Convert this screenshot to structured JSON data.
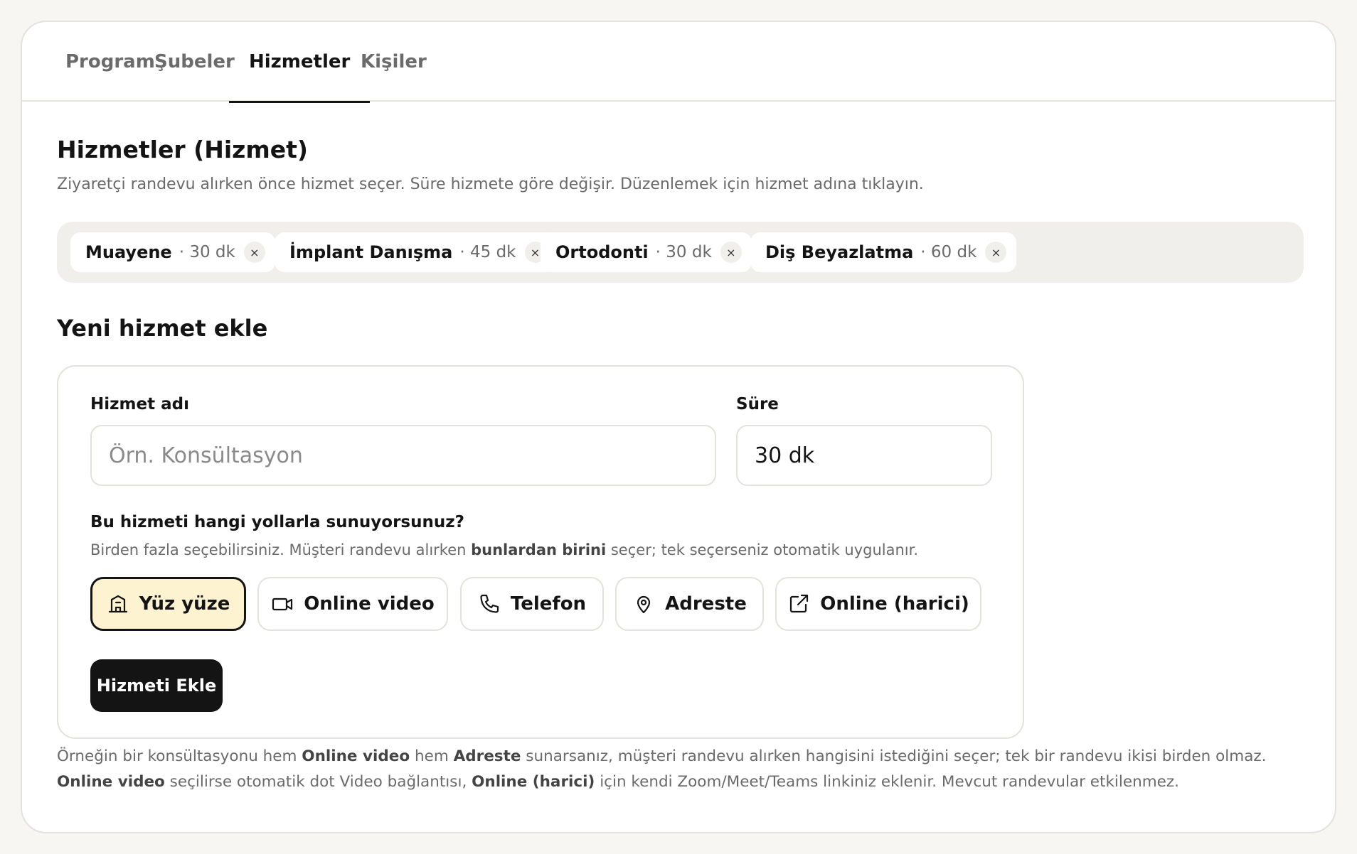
{
  "tabs": [
    {
      "label": "Program"
    },
    {
      "label": "Şubeler"
    },
    {
      "label": "Hizmetler",
      "active": true
    },
    {
      "label": "Kişiler"
    }
  ],
  "services": {
    "title": "Hizmetler (Hizmet)",
    "subtitle": "Ziyaretçi randevu alırken önce hizmet seçer. Süre hizmete göre değişir. Düzenlemek için hizmet adına tıklayın.",
    "items": [
      {
        "name": "Muayene",
        "duration": "· 30 dk"
      },
      {
        "name": "İmplant Danışma",
        "duration": "· 45 dk"
      },
      {
        "name": "Ortodonti",
        "duration": "· 30 dk"
      },
      {
        "name": "Diş Beyazlatma",
        "duration": "· 60 dk"
      }
    ],
    "remove_glyph": "×"
  },
  "new_service": {
    "title": "Yeni hizmet ekle",
    "name_label": "Hizmet adı",
    "name_placeholder": "Örn. Konsültasyon",
    "name_value": "",
    "duration_label": "Süre",
    "duration_value": "30 dk",
    "question": "Bu hizmeti hangi yollarla sunuyorsunuz?",
    "hint_prefix": "Birden fazla seçebilirsiniz. Müşteri randevu alırken ",
    "hint_bold": "bunlardan birini",
    "hint_suffix": " seçer; tek seçerseniz otomatik uygulanır.",
    "options": [
      {
        "label": "Yüz yüze",
        "icon": "building-icon",
        "selected": true
      },
      {
        "label": "Online video",
        "icon": "video-icon",
        "selected": false
      },
      {
        "label": "Telefon",
        "icon": "phone-icon",
        "selected": false
      },
      {
        "label": "Adreste",
        "icon": "map-pin-icon",
        "selected": false
      },
      {
        "label": "Online (harici)",
        "icon": "external-link-icon",
        "selected": false
      }
    ],
    "submit_label": "Hizmeti Ekle"
  },
  "note": {
    "p1": "Örneğin bir konsültasyonu hem ",
    "b1": "Online video",
    "p2": " hem ",
    "b2": "Adreste",
    "p3": " sunarsanız, müşteri randevu alırken hangisini istediğini seçer; tek bir randevu ikisi birden olmaz. ",
    "b3": "Online video",
    "p4": " seçilirse otomatik dot Video bağlantısı, ",
    "b4": "Online (harici)",
    "p5": " için kendi Zoom/Meet/Teams linkiniz eklenir. Mevcut randevular etkilenmez."
  },
  "colors": {
    "selected_option_bg": "#fdf3d1",
    "primary_button_bg": "#141414",
    "chip_row_bg": "#f0efec"
  }
}
